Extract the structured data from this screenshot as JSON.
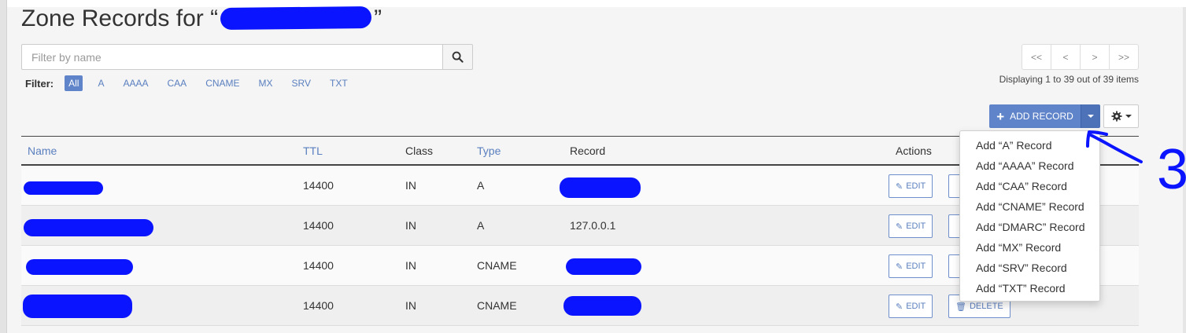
{
  "page": {
    "title_prefix": "Zone Records for “",
    "title_suffix": "”"
  },
  "search": {
    "placeholder": "Filter by name",
    "value": ""
  },
  "filter": {
    "label": "Filter:",
    "options": [
      "All",
      "A",
      "AAAA",
      "CAA",
      "CNAME",
      "MX",
      "SRV",
      "TXT"
    ],
    "active": "All"
  },
  "pagination": {
    "first": "<<",
    "prev": "<",
    "next": ">",
    "last": ">>",
    "display_text": "Displaying 1 to 39 out of 39 items"
  },
  "toolbar": {
    "add_record_label": "ADD RECORD"
  },
  "table": {
    "headers": {
      "name": "Name",
      "ttl": "TTL",
      "class": "Class",
      "type": "Type",
      "record": "Record",
      "actions": "Actions"
    },
    "rows": [
      {
        "ttl": "14400",
        "class": "IN",
        "type": "A",
        "record": ""
      },
      {
        "ttl": "14400",
        "class": "IN",
        "type": "A",
        "record": "127.0.0.1"
      },
      {
        "ttl": "14400",
        "class": "IN",
        "type": "CNAME",
        "record": ""
      },
      {
        "ttl": "14400",
        "class": "IN",
        "type": "CNAME",
        "record": ""
      }
    ],
    "edit_label": "EDIT",
    "delete_label": "DELETE"
  },
  "dropdown": {
    "items": [
      "Add “A” Record",
      "Add “AAAA” Record",
      "Add “CAA” Record",
      "Add “CNAME” Record",
      "Add “DMARC” Record",
      "Add “MX” Record",
      "Add “SRV” Record",
      "Add “TXT” Record"
    ]
  },
  "annotation": {
    "label": "3"
  },
  "colors": {
    "accent": "#5f84c9",
    "link": "#5a7fbf",
    "redaction": "#0a14ff"
  }
}
